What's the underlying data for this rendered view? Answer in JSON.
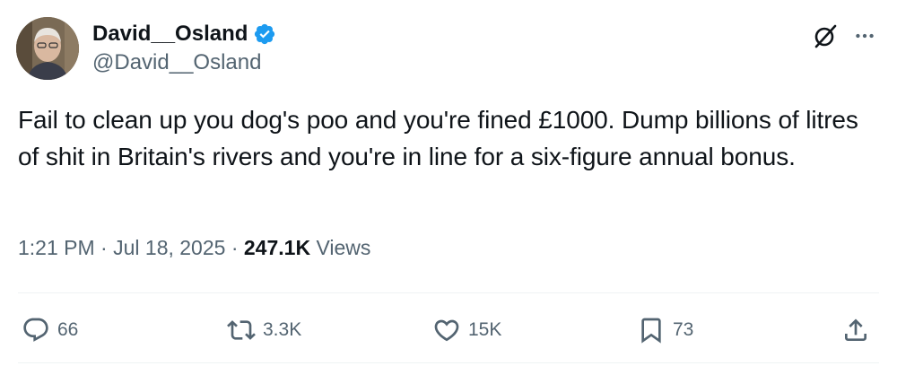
{
  "author": {
    "display_name": "David__Osland",
    "handle": "@David__Osland",
    "verified": true
  },
  "tweet": {
    "text": "Fail to clean up you dog's poo and you're fined £1000. Dump billions of litres of shit in Britain's rivers and you're in line for a six-figure annual bonus.",
    "time": "1:21 PM",
    "separator": "·",
    "date": "Jul 18, 2025",
    "views_count": "247.1K",
    "views_label": "Views"
  },
  "actions": {
    "replies": "66",
    "reposts": "3.3K",
    "likes": "15K",
    "bookmarks": "73"
  },
  "icons": {
    "verified": "verified-badge-icon",
    "grok": "grok-icon",
    "more": "more-icon",
    "reply": "reply-icon",
    "repost": "repost-icon",
    "like": "heart-icon",
    "bookmark": "bookmark-icon",
    "share": "share-icon"
  },
  "colors": {
    "text": "#0f1419",
    "secondary": "#536471",
    "verified": "#1d9bf0",
    "divider": "#eff3f4"
  }
}
